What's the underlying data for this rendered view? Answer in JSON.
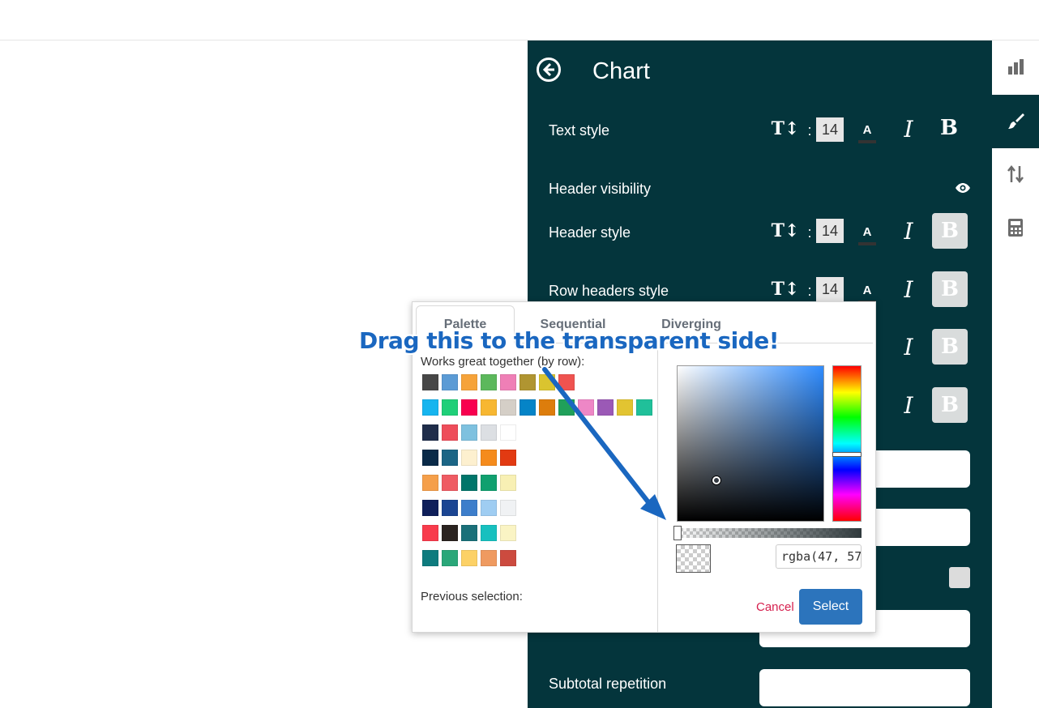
{
  "panel": {
    "title": "Chart",
    "rows": {
      "text_style": {
        "label": "Text style",
        "size": "14"
      },
      "header_visibility": {
        "label": "Header visibility"
      },
      "header_style": {
        "label": "Header style",
        "size": "14"
      },
      "row_headers_style": {
        "label": "Row headers style",
        "size": "14"
      },
      "subtotal_repetition": {
        "label": "Subtotal repetition"
      }
    },
    "font_color_glyph": "A",
    "italic_glyph": "I",
    "bold_glyph": "B",
    "size_glyph": "T↕",
    "colon": ":"
  },
  "rail": {
    "items": [
      {
        "icon": "bar-chart-icon",
        "active": false
      },
      {
        "icon": "paintbrush-icon",
        "active": true
      },
      {
        "icon": "sort-arrows-icon",
        "active": false
      },
      {
        "icon": "calculator-icon",
        "active": false
      }
    ]
  },
  "picker": {
    "tabs": [
      "Palette",
      "Sequential",
      "Diverging"
    ],
    "active_tab": "Palette",
    "works_label": "Works great together (by row):",
    "swatch_rows": [
      [
        "#474747",
        "#5b9bd5",
        "#f6a33a",
        "#5cb85c",
        "#ef7fb6",
        "#b09531",
        "#dac42f",
        "#ef5350"
      ],
      [
        "#16b5ef",
        "#1fcf78",
        "#f8004f",
        "#f7b731",
        "#d5cfc7",
        "#0584c7",
        "#dd7d0c",
        "#20a05a",
        "#ee87c6",
        "#9b59b6",
        "#e2c431",
        "#20c09a"
      ],
      [
        "#1f2d4a",
        "#ee4d5a",
        "#7ec1df",
        "#dcdfe3",
        "#ffffff"
      ],
      [
        "#0a2a48",
        "#1b6585",
        "#fdf0cf",
        "#f58b1c",
        "#e23a12"
      ],
      [
        "#f59f4a",
        "#ef5b63",
        "#00756a",
        "#10a06f",
        "#f8f0b4"
      ],
      [
        "#0f1f5a",
        "#1b4592",
        "#3d7ecb",
        "#9fcdf2",
        "#f0f2f4"
      ],
      [
        "#f83b4c",
        "#2a2320",
        "#1a7079",
        "#17c0bf",
        "#faf4c4"
      ],
      [
        "#0e7b7e",
        "#2aa779",
        "#fcd166",
        "#ef9a60",
        "#cc4b3f"
      ]
    ],
    "previous_label": "Previous selection:",
    "rgba_value": "rgba(47, 57",
    "cancel_label": "Cancel",
    "select_label": "Select"
  },
  "annotation": {
    "text": "Drag this to the transparent side!",
    "color": "#1a67c0"
  }
}
